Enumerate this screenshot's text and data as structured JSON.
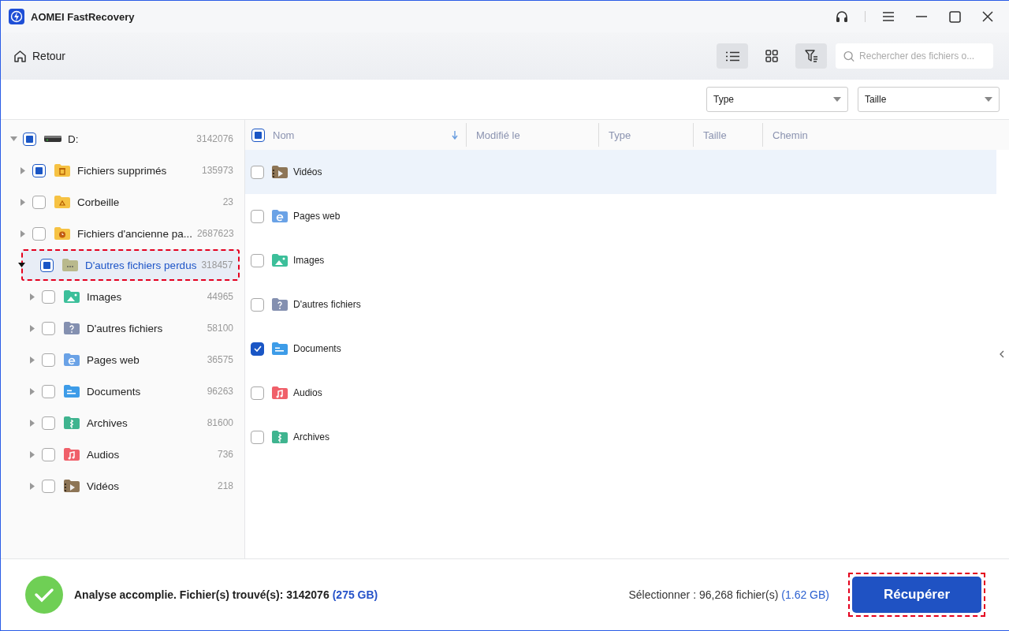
{
  "window": {
    "title": "AOMEI FastRecovery"
  },
  "toolbar": {
    "back": "Retour",
    "views": [
      {
        "kind": "list",
        "selected": true
      },
      {
        "kind": "grid",
        "selected": false
      }
    ],
    "filter_active": true,
    "search": {
      "placeholder": "Rechercher des fichiers o..."
    }
  },
  "filters": [
    {
      "value": "Type"
    },
    {
      "value": "Taille"
    }
  ],
  "tree": [
    {
      "label": "D:",
      "count": "3142076",
      "kind": "drive",
      "checked": false,
      "partial": true,
      "expanded": true,
      "selected": false,
      "highlighted": false,
      "children": [
        {
          "label": "Fichiers supprimés",
          "count": "135973",
          "kind": "trash-folder",
          "checked": false,
          "partial": true,
          "expanded": false,
          "selected": false,
          "highlighted": false
        },
        {
          "label": "Corbeille",
          "count": "23",
          "kind": "recycle-folder",
          "checked": false,
          "partial": false,
          "expanded": false,
          "selected": false,
          "highlighted": false
        },
        {
          "label": "Fichiers d'ancienne pa...",
          "count": "2687623",
          "kind": "clock-folder",
          "checked": false,
          "partial": false,
          "expanded": false,
          "selected": false,
          "highlighted": false
        },
        {
          "label": "D'autres fichiers perdus",
          "count": "318457",
          "kind": "other-folder",
          "checked": false,
          "partial": true,
          "expanded": true,
          "selected": true,
          "highlighted": true,
          "children": [
            {
              "label": "Images",
              "count": "44965",
              "kind": "images",
              "checked": false,
              "partial": false,
              "expanded": false,
              "selected": false,
              "highlighted": false
            },
            {
              "label": "D'autres fichiers",
              "count": "58100",
              "kind": "other",
              "checked": false,
              "partial": false,
              "expanded": false,
              "selected": false,
              "highlighted": false
            },
            {
              "label": "Pages web",
              "count": "36575",
              "kind": "web",
              "checked": false,
              "partial": false,
              "expanded": false,
              "selected": false,
              "highlighted": false
            },
            {
              "label": "Documents",
              "count": "96263",
              "kind": "documents",
              "checked": false,
              "partial": false,
              "expanded": false,
              "selected": false,
              "highlighted": false
            },
            {
              "label": "Archives",
              "count": "81600",
              "kind": "archives",
              "checked": false,
              "partial": false,
              "expanded": false,
              "selected": false,
              "highlighted": false
            },
            {
              "label": "Audios",
              "count": "736",
              "kind": "audios",
              "checked": false,
              "partial": false,
              "expanded": false,
              "selected": false,
              "highlighted": false
            },
            {
              "label": "Vidéos",
              "count": "218",
              "kind": "videos",
              "checked": false,
              "partial": false,
              "expanded": false,
              "selected": false,
              "highlighted": false
            }
          ]
        }
      ]
    }
  ],
  "table": {
    "header_checked": false,
    "header_partial": true,
    "columns": [
      {
        "label": "Nom",
        "sorted": true
      },
      {
        "label": "Modifié le",
        "sorted": false
      },
      {
        "label": "Type",
        "sorted": false
      },
      {
        "label": "Taille",
        "sorted": false
      },
      {
        "label": "Chemin",
        "sorted": false
      }
    ],
    "rows": [
      {
        "name": "Vidéos",
        "kind": "videos",
        "checked": false,
        "selected": true
      },
      {
        "name": "Pages web",
        "kind": "web",
        "checked": false,
        "selected": false
      },
      {
        "name": "Images",
        "kind": "images",
        "checked": false,
        "selected": false
      },
      {
        "name": "D'autres fichiers",
        "kind": "other",
        "checked": false,
        "selected": false
      },
      {
        "name": "Documents",
        "kind": "documents",
        "checked": true,
        "selected": false
      },
      {
        "name": "Audios",
        "kind": "audios",
        "checked": false,
        "selected": false
      },
      {
        "name": "Archives",
        "kind": "archives",
        "checked": false,
        "selected": false
      }
    ]
  },
  "status": {
    "message": "Analyse accomplie. Fichier(s) trouvé(s): 3142076",
    "size": "(275 GB)",
    "selection": "Sélectionner : 96,268 fichier(s)",
    "selection_size": "(1.62 GB)"
  },
  "recover_button": {
    "label": "Récupérer",
    "highlighted": true
  }
}
